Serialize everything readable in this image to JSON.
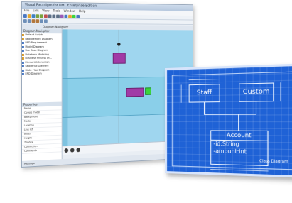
{
  "window": {
    "title": "Visual Paradigm for UML Enterprise Edition",
    "menu": [
      "File",
      "Edit",
      "View",
      "Tools",
      "Window",
      "Help"
    ],
    "tab": "Diagram Navigator"
  },
  "left_panel": {
    "header": "Diagram Navigator",
    "tree": [
      "Default Scripts",
      "Requirement Diagram",
      "BPD Requirement",
      "Model Diagram",
      "Use Case Diagram",
      "Database Modeling",
      "Business Process Di...",
      "Element Interaction",
      "Sequence Diagram",
      "State Flow Diagram",
      "ERD Diagram"
    ],
    "properties_header": "Properties",
    "properties": [
      "Name",
      "Covers model",
      "Background",
      "Model",
      "Location",
      "Line left",
      "Width",
      "Height",
      "Z Index",
      "Connection",
      "Comments"
    ]
  },
  "status": "Message",
  "blueprint": {
    "class1": "Staff",
    "class2": "Custom",
    "class3": "Account",
    "attr1": "-id:String",
    "attr2": "-amount:int",
    "caption": "Class Diagram"
  },
  "colors": {
    "blueprint": "#1f62d6",
    "lane": "#9fd6ef",
    "purple_node": "#a13aa6",
    "green_node": "#3bd43b"
  }
}
